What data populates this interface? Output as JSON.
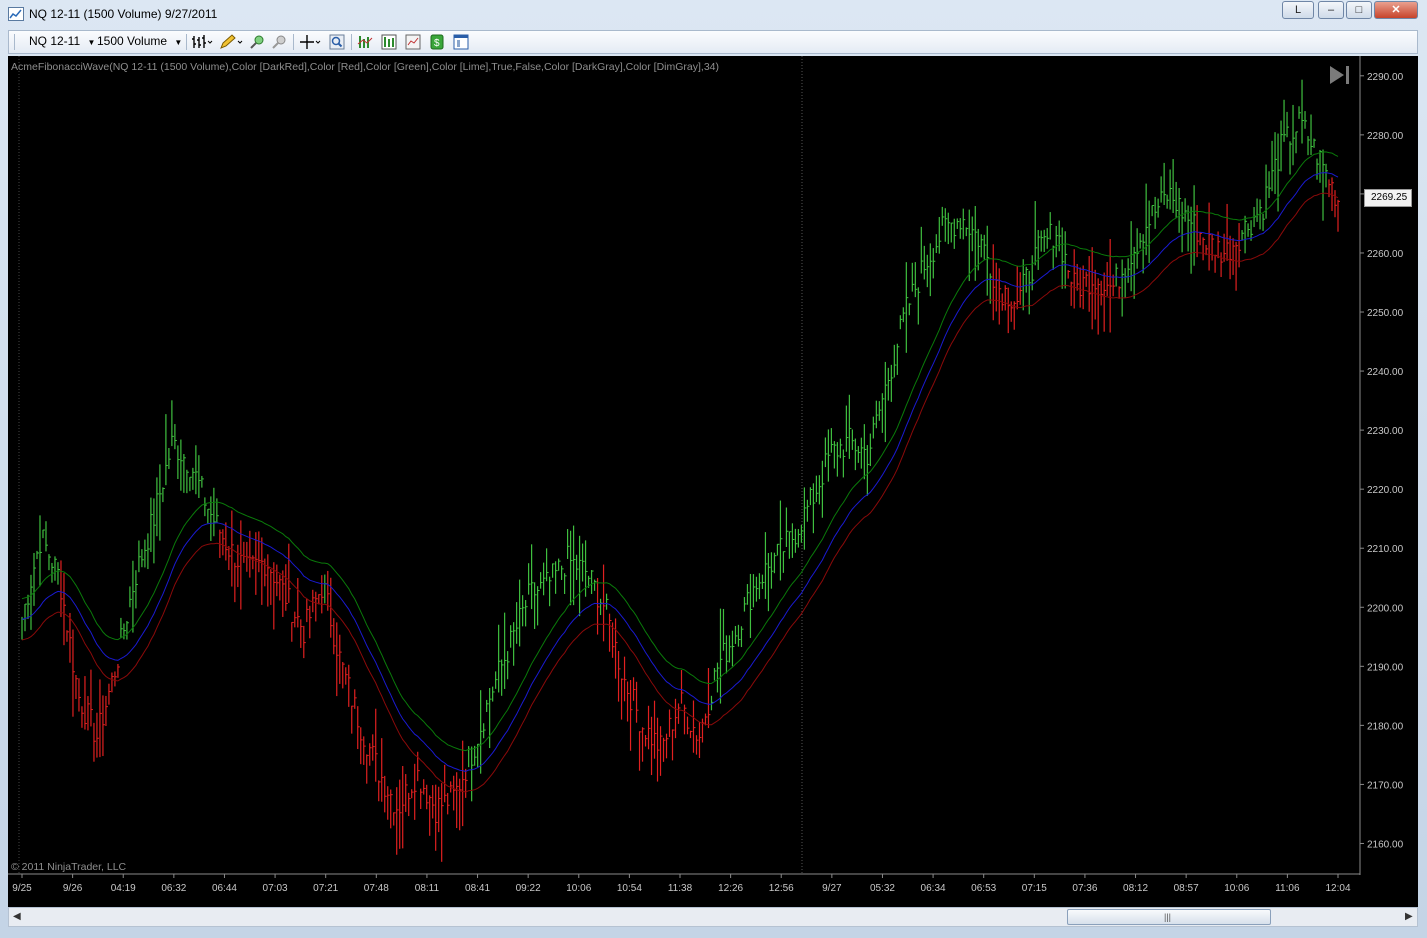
{
  "window": {
    "title": "NQ 12-11 (1500 Volume)  9/27/2011",
    "buttons": {
      "layout": "L",
      "minimize": "–",
      "maximize": "□",
      "close": "✕"
    }
  },
  "toolbar": {
    "instrument": "NQ 12-11",
    "interval": "1500 Volume",
    "icons": [
      "bar-type-icon",
      "drawing-pencil-icon",
      "zoom-in-icon",
      "zoom-out-icon",
      "crosshair-icon",
      "magnifier-icon",
      "indicators-icon",
      "strategies-icon",
      "chart-properties-icon",
      "data-box-icon",
      "templates-icon"
    ]
  },
  "chart": {
    "indicator_label": "AcmeFibonacciWave(NQ 12-11 (1500 Volume),Color [DarkRed],Color [Red],Color [Green],Color [Lime],True,False,Color [DarkGray],Color [DimGray],34)",
    "copyright": "© 2011 NinjaTrader, LLC",
    "last_price": "2269.25",
    "colors": {
      "background": "#000000",
      "up_bar": "#3fbf3f",
      "down_bar": "#e02020",
      "wave_upper": "#0a7a0a",
      "wave_mid": "#1a1ad0",
      "wave_lower": "#8a0a0a",
      "axis_text": "#c8c8c8"
    }
  },
  "chart_data": {
    "type": "line",
    "title": "",
    "xlabel": "",
    "ylabel": "",
    "ylim": [
      2155,
      2292
    ],
    "y_ticks": [
      "2290.00",
      "2280.00",
      "2270.00",
      "2260.00",
      "2250.00",
      "2240.00",
      "2230.00",
      "2220.00",
      "2210.00",
      "2200.00",
      "2190.00",
      "2180.00",
      "2170.00",
      "2160.00"
    ],
    "x_ticks": [
      "9/25",
      "9/26",
      "04:19",
      "06:32",
      "06:44",
      "07:03",
      "07:21",
      "07:48",
      "08:11",
      "08:41",
      "09:22",
      "10:06",
      "10:54",
      "11:38",
      "12:26",
      "12:56",
      "9/27",
      "05:32",
      "06:34",
      "06:53",
      "07:15",
      "07:36",
      "08:12",
      "08:57",
      "10:06",
      "11:06",
      "12:04"
    ],
    "series": [
      {
        "values": [
          2198,
          2212,
          2205,
          2185,
          2178,
          2190,
          2205,
          2215,
          2228,
          2224,
          2216,
          2210,
          2206,
          2208,
          2202,
          2196,
          2204,
          2190,
          2180,
          2172,
          2166,
          2172,
          2166,
          2168,
          2176,
          2186,
          2194,
          2202,
          2204,
          2208,
          2206,
          2200,
          2188,
          2180,
          2176,
          2184,
          2178,
          2190,
          2196,
          2204,
          2208,
          2212,
          2218,
          2226,
          2228,
          2226,
          2238,
          2250,
          2258,
          2264,
          2266,
          2262,
          2254,
          2252,
          2260,
          2264,
          2254,
          2256,
          2254,
          2260,
          2266,
          2270,
          2266,
          2262,
          2260,
          2264,
          2268,
          2278,
          2282,
          2276,
          2269
        ]
      }
    ]
  }
}
